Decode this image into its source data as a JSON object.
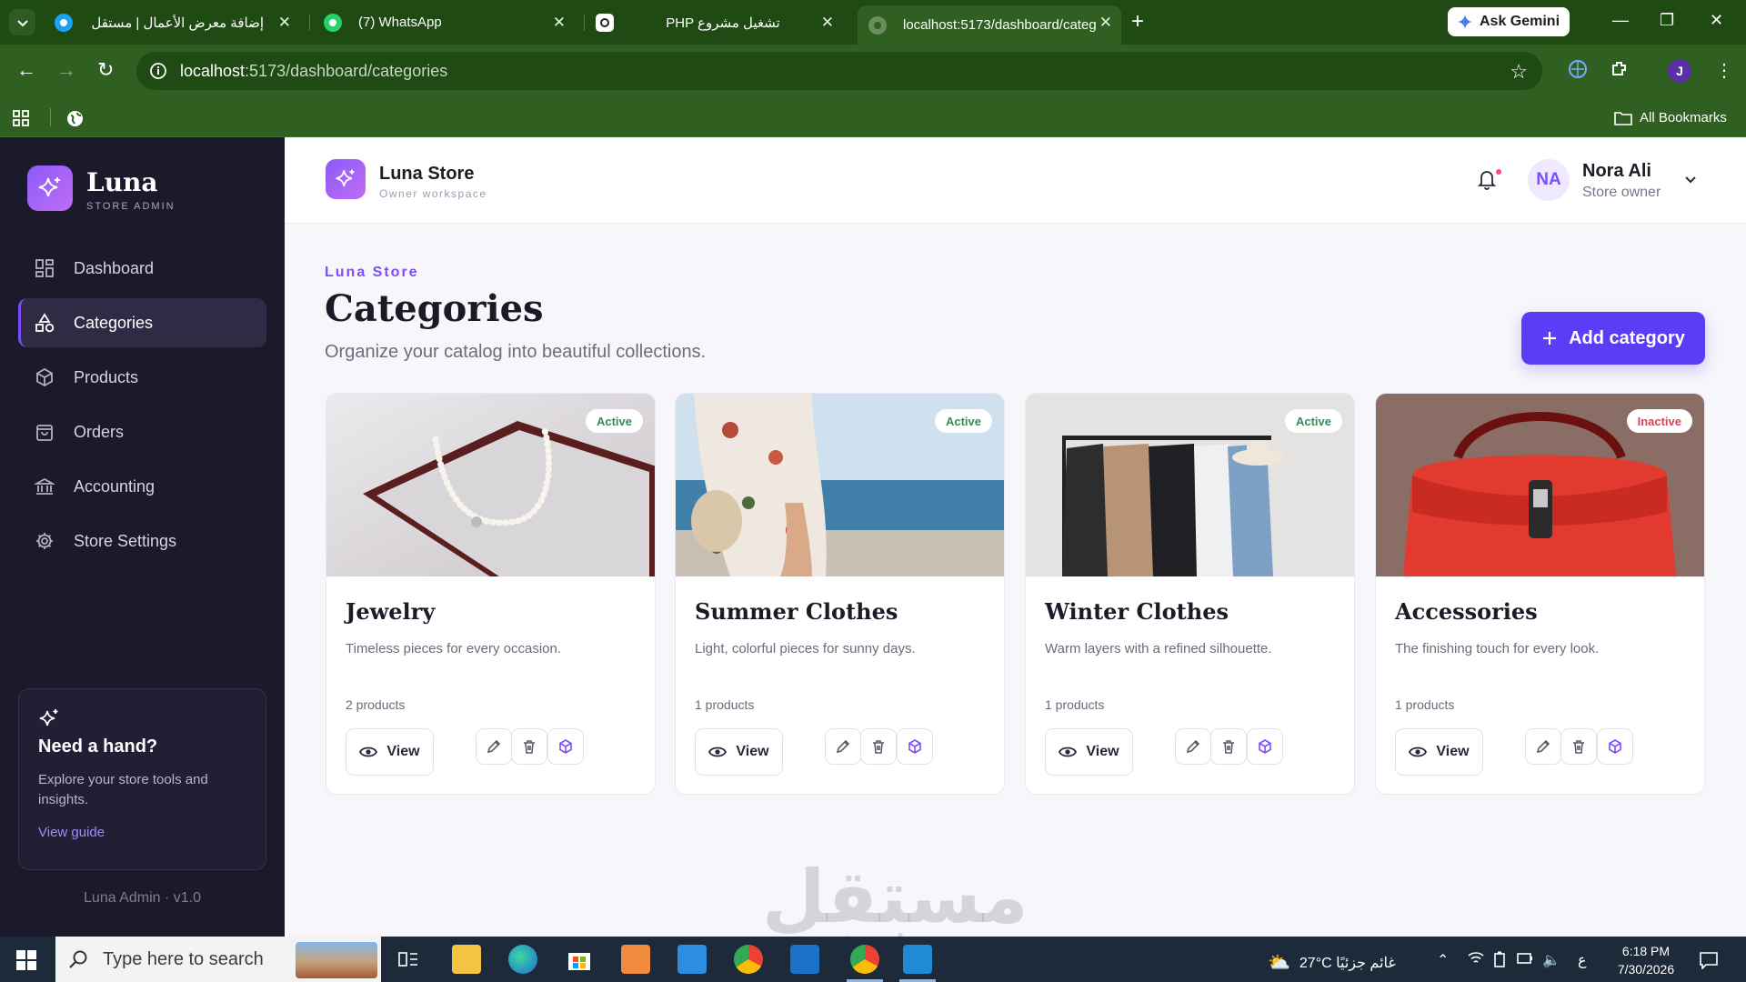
{
  "browser": {
    "tabs": [
      {
        "title": "إضافة معرض الأعمال | مستقل",
        "icon": "mostaql-icon",
        "active": false
      },
      {
        "title": "(7) WhatsApp",
        "icon": "whatsapp-icon",
        "active": false
      },
      {
        "title": "PHP تشغيل مشروع",
        "icon": "chatgpt-icon",
        "active": false
      },
      {
        "title": "localhost:5173/dashboard/categ",
        "icon": "page-icon",
        "active": true
      }
    ],
    "ask_gemini": "Ask Gemini",
    "url_host": "localhost",
    "url_path": ":5173/dashboard/categories",
    "all_bookmarks": "All Bookmarks",
    "profile_initial": "J"
  },
  "sidebar": {
    "brand_name": "Luna",
    "brand_sub": "STORE ADMIN",
    "items": [
      {
        "label": "Dashboard",
        "icon": "grid-icon",
        "active": false
      },
      {
        "label": "Categories",
        "icon": "shapes-icon",
        "active": true
      },
      {
        "label": "Products",
        "icon": "box-icon",
        "active": false
      },
      {
        "label": "Orders",
        "icon": "bag-icon",
        "active": false
      },
      {
        "label": "Accounting",
        "icon": "bank-icon",
        "active": false
      },
      {
        "label": "Store Settings",
        "icon": "gear-icon",
        "active": false
      }
    ],
    "help": {
      "title": "Need a hand?",
      "text": "Explore your store tools and insights.",
      "link": "View guide"
    },
    "version": "Luna Admin · v1.0"
  },
  "topbar": {
    "store_name": "Luna Store",
    "store_sub": "Owner workspace",
    "user_initials": "NA",
    "user_name": "Nora Ali",
    "user_role": "Store owner"
  },
  "page": {
    "eyebrow": "Luna Store",
    "title": "Categories",
    "subtitle": "Organize your catalog into beautiful collections.",
    "add_button": "Add category"
  },
  "categories": [
    {
      "name": "Jewelry",
      "description": "Timeless pieces for every occasion.",
      "count": "2 products",
      "status": "Active",
      "image": "pearl necklace"
    },
    {
      "name": "Summer Clothes",
      "description": "Light, colorful pieces for sunny days.",
      "count": "1 products",
      "status": "Active",
      "image": "floral summer dress"
    },
    {
      "name": "Winter Clothes",
      "description": "Warm layers with a refined silhouette.",
      "count": "1 products",
      "status": "Active",
      "image": "clothes rack"
    },
    {
      "name": "Accessories",
      "description": "The finishing touch for every look.",
      "count": "1 products",
      "status": "Inactive",
      "image": "red handbag"
    }
  ],
  "card_actions": {
    "view": "View"
  },
  "watermark": {
    "ar": "مستقل",
    "en": "mostaql.com"
  },
  "taskbar": {
    "search_placeholder": "Type here to search",
    "weather": "27°C غائم جزئيًا",
    "lang": "ع",
    "time": "6:18 PM",
    "date": "7/30/2026"
  },
  "colors": {
    "accent": "#5b3df5",
    "sidebar_bg": "#1b1a2b",
    "browser_green": "#2f5f21",
    "active_badge": "#2e8f55",
    "inactive_badge": "#e0405c"
  }
}
